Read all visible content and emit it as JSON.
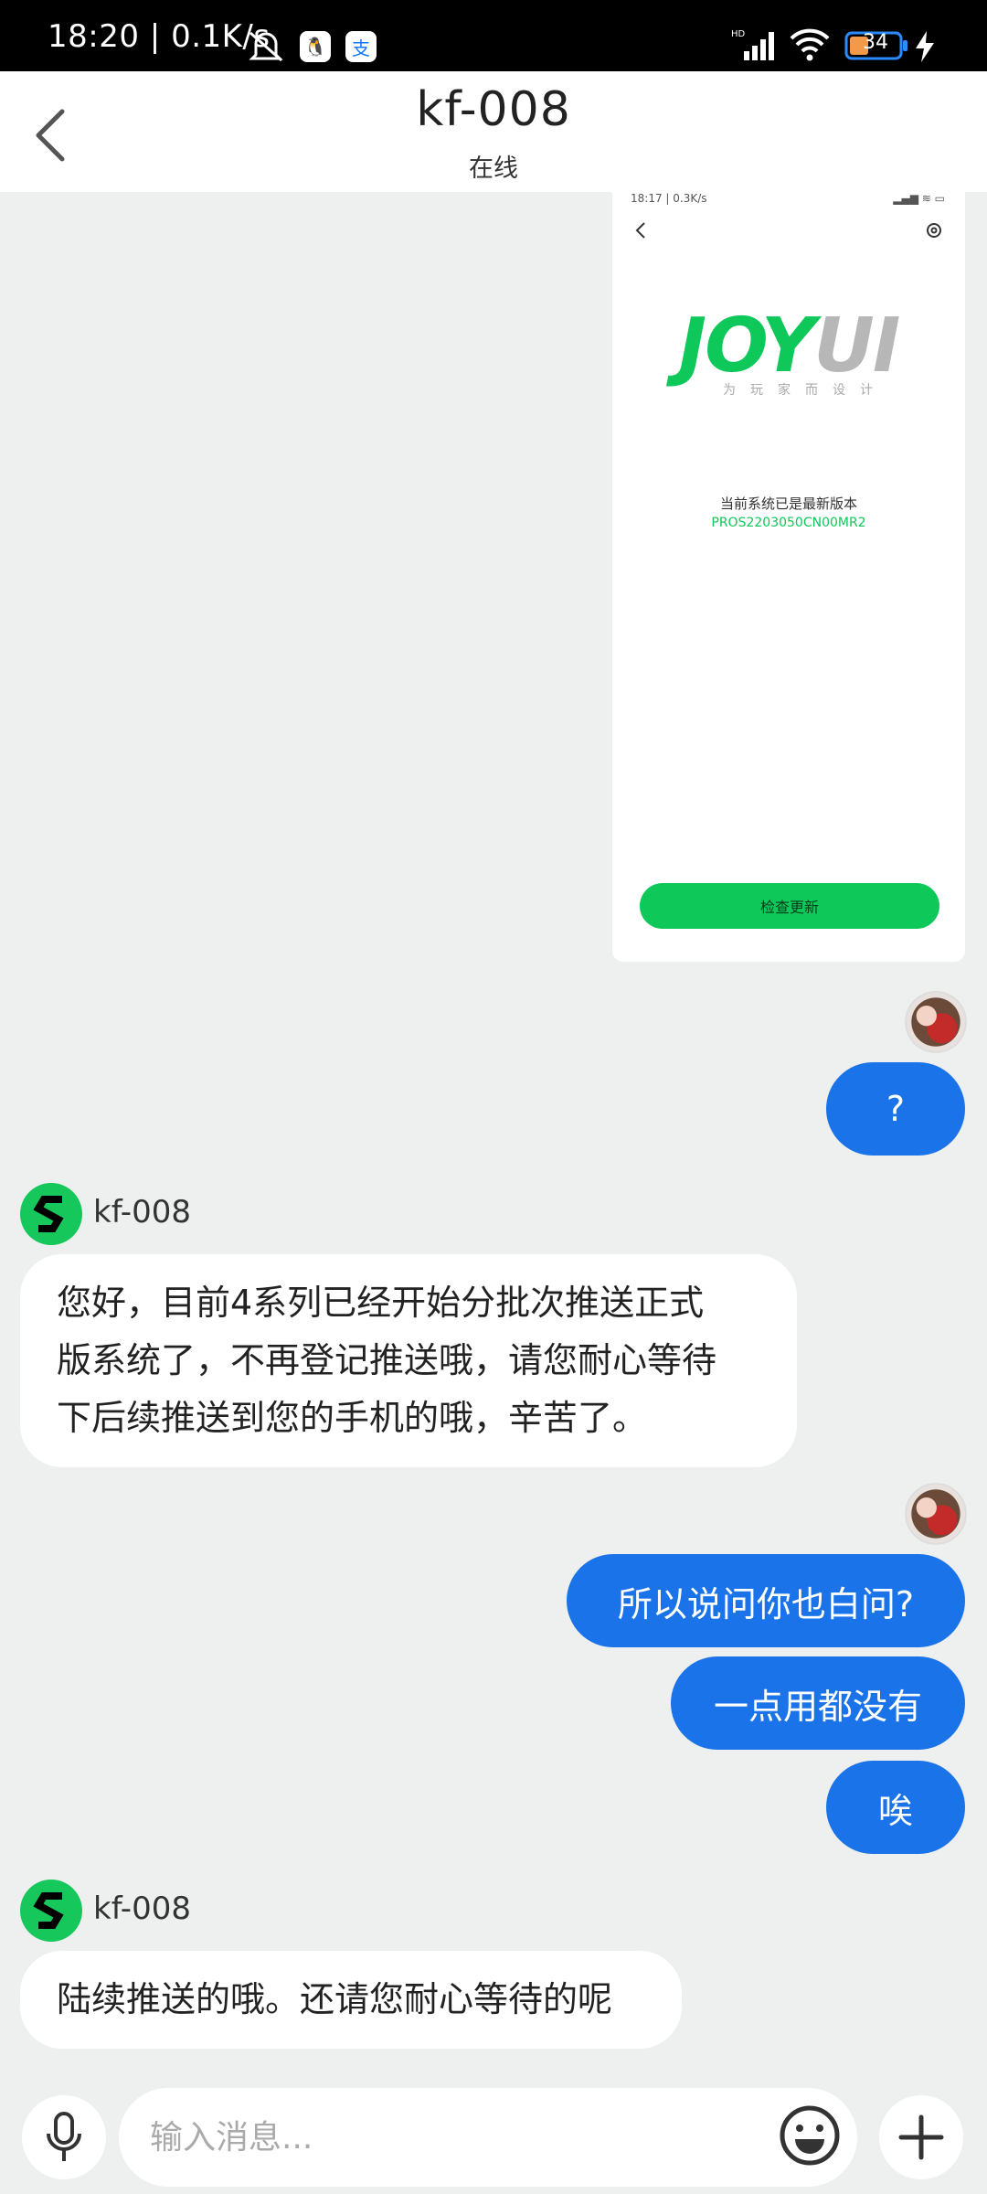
{
  "status_bar": {
    "time": "18:20",
    "speed": "0.1K/s",
    "battery": "34"
  },
  "header": {
    "title": "kf-008",
    "subtitle": "在线"
  },
  "shared_screenshot": {
    "mini_time": "18:17 | 0.3K/s",
    "logo_main": "JOY",
    "logo_accent": "UI",
    "logo_tagline": "为玩家而设计",
    "system_status": "当前系统已是最新版本",
    "version": "PROS2203050CN00MR2",
    "check_button": "检查更新"
  },
  "messages": [
    {
      "from": "user",
      "text": "?"
    },
    {
      "from": "kf",
      "name": "kf-008",
      "lines": [
        "您好，目前4系列已经开始分批次推送正式",
        "版系统了，不再登记推送哦，请您耐心等待",
        "下后续推送到您的手机的哦，辛苦了。"
      ]
    },
    {
      "from": "user",
      "text": "所以说问你也白问?"
    },
    {
      "from": "user",
      "text": "一点用都没有"
    },
    {
      "from": "user",
      "text": "唉"
    },
    {
      "from": "kf",
      "name": "kf-008",
      "text": "陆续推送的哦。还请您耐心等待的呢"
    }
  ],
  "input": {
    "placeholder": "输入消息..."
  },
  "colors": {
    "accent_blue": "#1a73e8",
    "kf_green": "#16c75b",
    "joy_green": "#0fc85a"
  }
}
